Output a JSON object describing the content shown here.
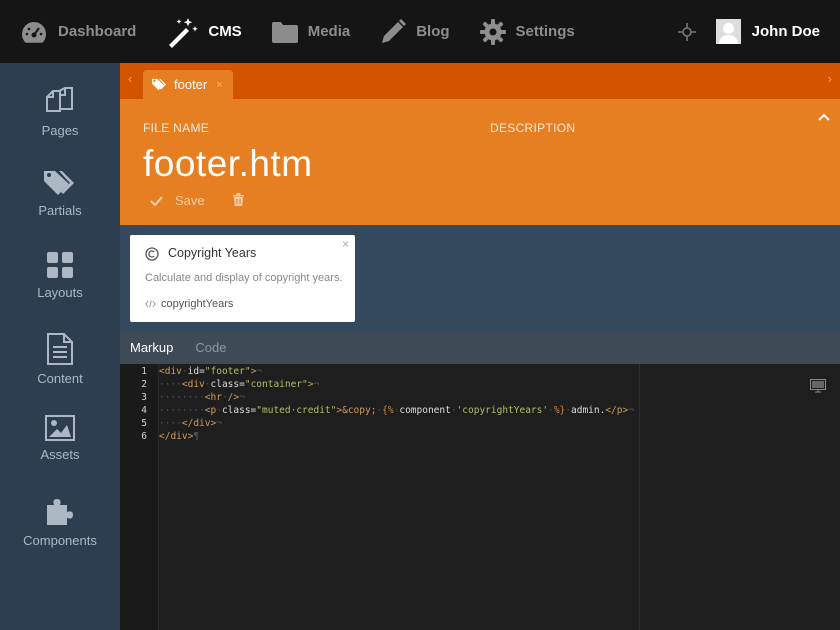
{
  "topbar": {
    "nav": [
      {
        "label": "Dashboard",
        "icon": "dashboard-icon"
      },
      {
        "label": "CMS",
        "icon": "magic-wand-icon"
      },
      {
        "label": "Media",
        "icon": "folder-icon"
      },
      {
        "label": "Blog",
        "icon": "pencil-icon"
      },
      {
        "label": "Settings",
        "icon": "gear-icon"
      }
    ],
    "user_name": "John Doe"
  },
  "sidebar": {
    "items": [
      {
        "label": "Pages",
        "icon": "pages-icon"
      },
      {
        "label": "Partials",
        "icon": "tags-icon"
      },
      {
        "label": "Layouts",
        "icon": "layouts-icon"
      },
      {
        "label": "Content",
        "icon": "content-icon"
      },
      {
        "label": "Assets",
        "icon": "image-icon"
      },
      {
        "label": "Components",
        "icon": "puzzle-icon"
      }
    ]
  },
  "tab": {
    "label": "footer",
    "close": "×"
  },
  "form": {
    "file_name_label": "FILE NAME",
    "description_label": "DESCRIPTION",
    "file_name": "footer.htm",
    "save_label": "Save"
  },
  "component": {
    "title": "Copyright Years",
    "description": "Calculate and display of copyright years.",
    "alias": "copyrightYears",
    "close": "×"
  },
  "editor_tabs": {
    "markup": "Markup",
    "code": "Code"
  },
  "editor": {
    "lines": [
      "1",
      "2",
      "3",
      "4",
      "5",
      "6"
    ]
  },
  "colors": {
    "topbar": "#151515",
    "sidebar": "#2d3e50",
    "accent": "#e67e22",
    "accent_dark": "#d35400"
  }
}
